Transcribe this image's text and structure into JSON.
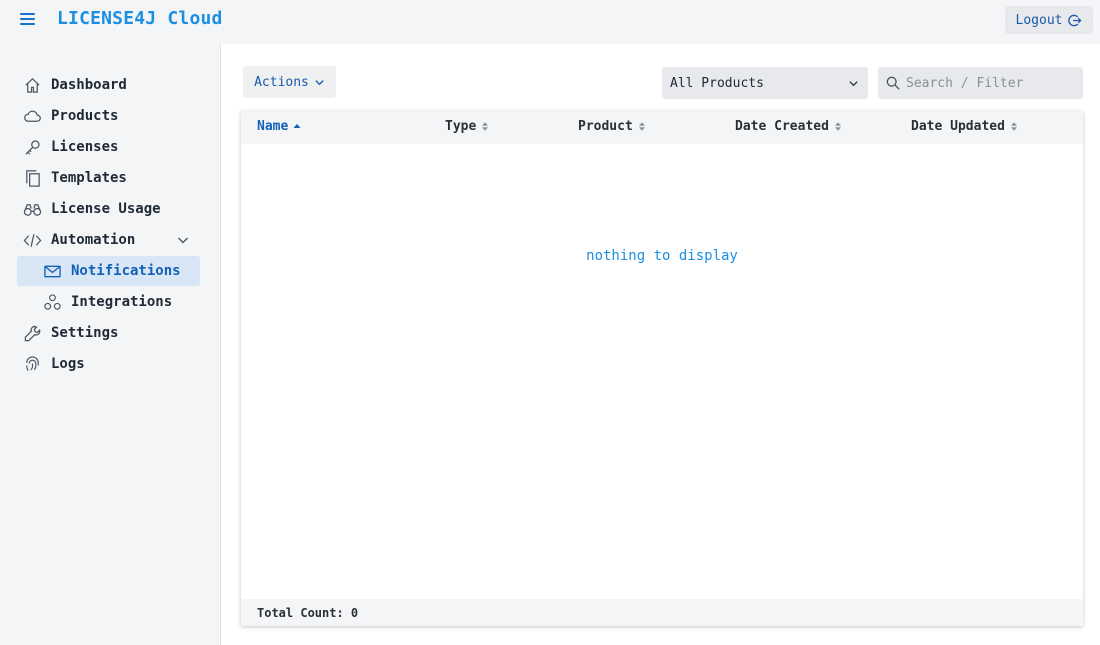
{
  "header": {
    "app_title": "LICENSE4J Cloud",
    "logout_label": "Logout"
  },
  "sidebar": {
    "items": [
      {
        "label": "Dashboard",
        "icon": "home-icon"
      },
      {
        "label": "Products",
        "icon": "cloud-icon"
      },
      {
        "label": "Licenses",
        "icon": "key-icon"
      },
      {
        "label": "Templates",
        "icon": "copy-icon"
      },
      {
        "label": "License Usage",
        "icon": "binoculars-icon"
      },
      {
        "label": "Automation",
        "icon": "code-icon",
        "expanded": true
      },
      {
        "label": "Notifications",
        "icon": "envelope-icon",
        "active": true
      },
      {
        "label": "Integrations",
        "icon": "integrations-icon"
      },
      {
        "label": "Settings",
        "icon": "wrench-icon"
      },
      {
        "label": "Logs",
        "icon": "fingerprint-icon"
      }
    ]
  },
  "toolbar": {
    "actions_label": "Actions",
    "product_filter_value": "All Products",
    "search_placeholder": "Search / Filter"
  },
  "table": {
    "columns": [
      {
        "label": "Name",
        "sorted": "asc"
      },
      {
        "label": "Type"
      },
      {
        "label": "Product"
      },
      {
        "label": "Date Created"
      },
      {
        "label": "Date Updated"
      }
    ],
    "empty_message": "nothing to display",
    "footer": "Total Count: 0"
  },
  "colors": {
    "accent": "#1c8fe3",
    "link": "#1260b8",
    "active_bg": "#d9e6f5"
  }
}
